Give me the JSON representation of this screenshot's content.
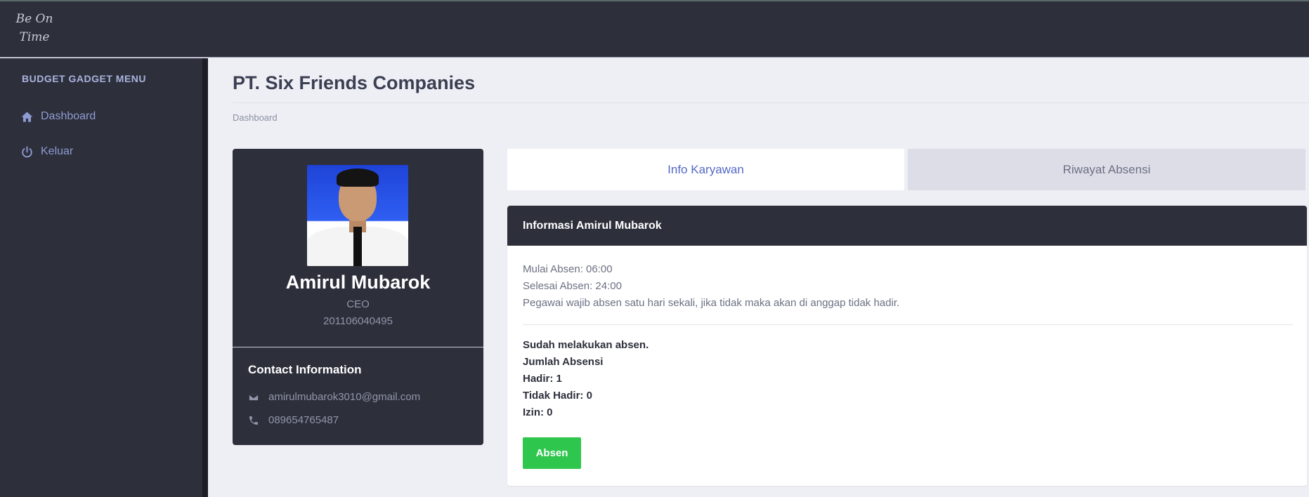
{
  "brand": {
    "logo_line1": "Be On",
    "logo_line2": "Time"
  },
  "sidebar": {
    "heading": "BUDGET GADGET MENU",
    "items": [
      {
        "label": "Dashboard",
        "icon": "home-icon"
      },
      {
        "label": "Keluar",
        "icon": "power-icon"
      }
    ]
  },
  "page": {
    "title": "PT. Six Friends Companies",
    "breadcrumb": "Dashboard"
  },
  "profile": {
    "name": "Amirul Mubarok",
    "role": "CEO",
    "id": "201106040495",
    "contact_title": "Contact Information",
    "email": "amirulmubarok3010@gmail.com",
    "phone": "089654765487"
  },
  "tabs": [
    {
      "label": "Info Karyawan",
      "active": true
    },
    {
      "label": "Riwayat Absensi",
      "active": false
    }
  ],
  "info": {
    "header": "Informasi Amirul Mubarok",
    "start": "Mulai Absen: 06:00",
    "end": "Selesai Absen: 24:00",
    "rule": "Pegawai wajib absen satu hari sekali, jika tidak maka akan di anggap tidak hadir.",
    "status": "Sudah melakukan absen.",
    "jumlah_label": "Jumlah Absensi",
    "hadir": "Hadir: 1",
    "tidak_hadir": "Tidak Hadir: 0",
    "izin": "Izin: 0",
    "button_label": "Absen"
  },
  "colors": {
    "sidebar_bg": "#2d2f3b",
    "accent": "#5468c7",
    "button": "#2fc64e",
    "page_bg": "#eeeff5"
  }
}
